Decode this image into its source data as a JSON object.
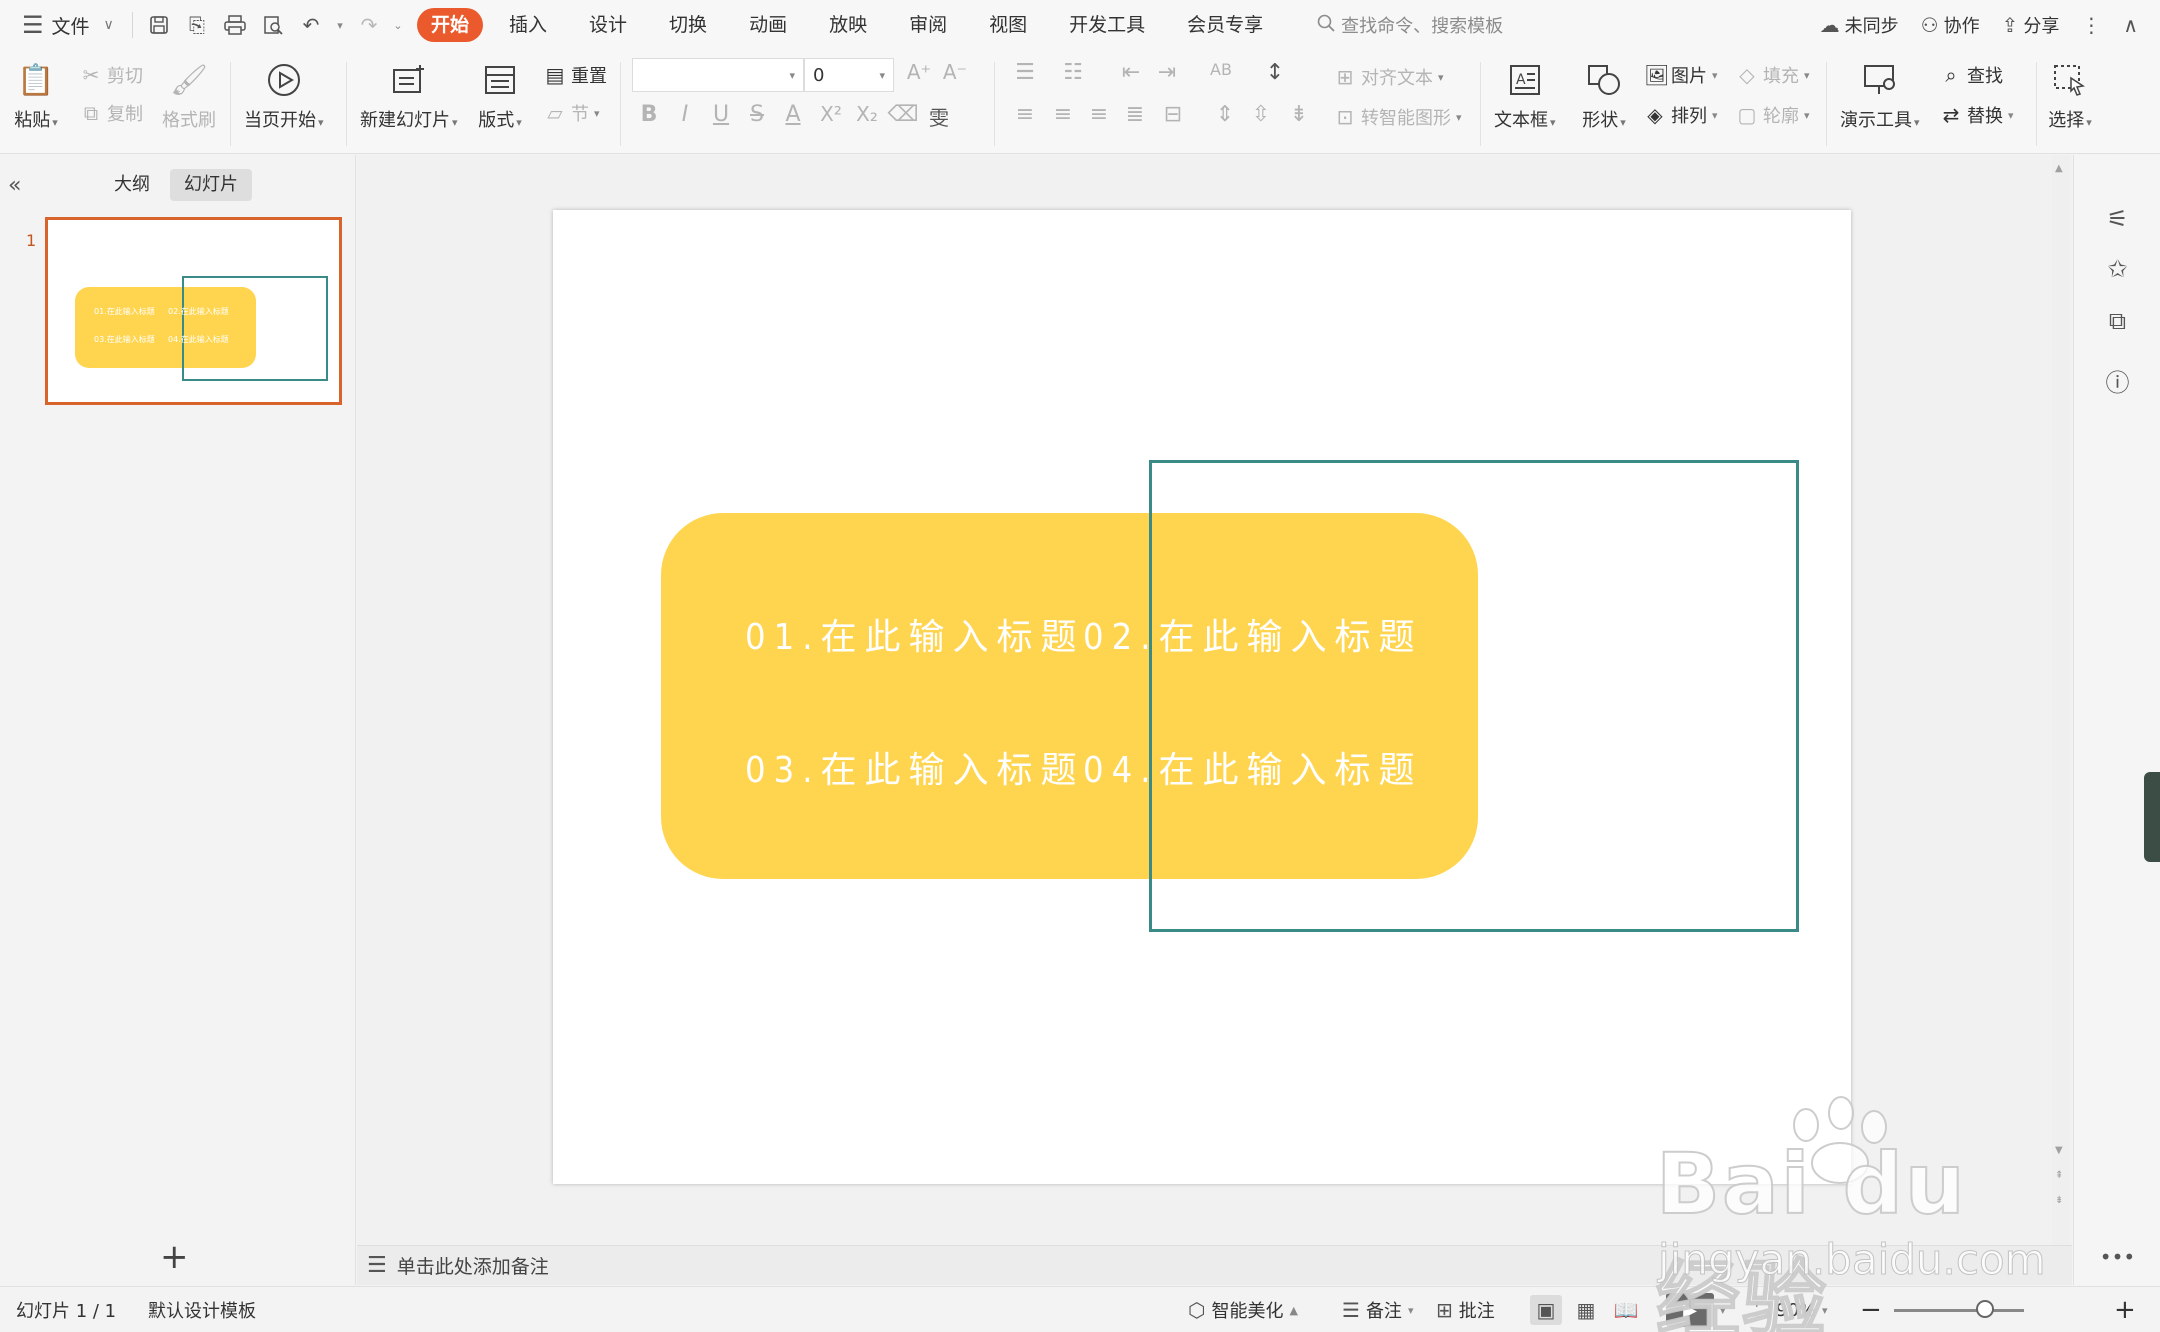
{
  "menubar": {
    "file_label": "文件",
    "tabs": [
      "开始",
      "插入",
      "设计",
      "切换",
      "动画",
      "放映",
      "审阅",
      "视图",
      "开发工具",
      "会员专享"
    ],
    "active_tab": "开始",
    "search_placeholder": "查找命令、搜索模板",
    "sync_label": "未同步",
    "collab_label": "协作",
    "share_label": "分享"
  },
  "ribbon": {
    "paste": "粘贴",
    "cut": "剪切",
    "copy": "复制",
    "format_painter": "格式刷",
    "from_current": "当页开始",
    "new_slide": "新建幻灯片",
    "layout": "版式",
    "reset": "重置",
    "section": "节",
    "font_name": "",
    "font_size": "0",
    "align_text": "对齐文本",
    "smart_shape": "转智能图形",
    "textbox": "文本框",
    "shape": "形状",
    "picture": "图片",
    "arrange": "排列",
    "fill": "填充",
    "outline": "轮廓",
    "presenter_tools": "演示工具",
    "find": "查找",
    "replace": "替换",
    "select": "选择"
  },
  "left_panel": {
    "tab_outline": "大纲",
    "tab_slides": "幻灯片",
    "active_tab": "幻灯片",
    "slide_number": "1"
  },
  "slide": {
    "titles": [
      "01.在此输入标题",
      "02.在此输入标题",
      "03.在此输入标题",
      "04.在此输入标题"
    ],
    "shape_color": "#ffd54f",
    "frame_color": "#3a8a88"
  },
  "notes": {
    "placeholder": "单击此处添加备注"
  },
  "status": {
    "slide_info": "幻灯片 1 / 1",
    "template": "默认设计模板",
    "smart_beautify": "智能美化",
    "notes_label": "备注",
    "comments_label": "批注",
    "zoom": "90%"
  },
  "watermark": {
    "brand": "Bai du 经验",
    "url": "jingyan.baidu.com"
  },
  "colors": {
    "accent": "#ea5a2c",
    "thumb_border": "#d9642b"
  }
}
